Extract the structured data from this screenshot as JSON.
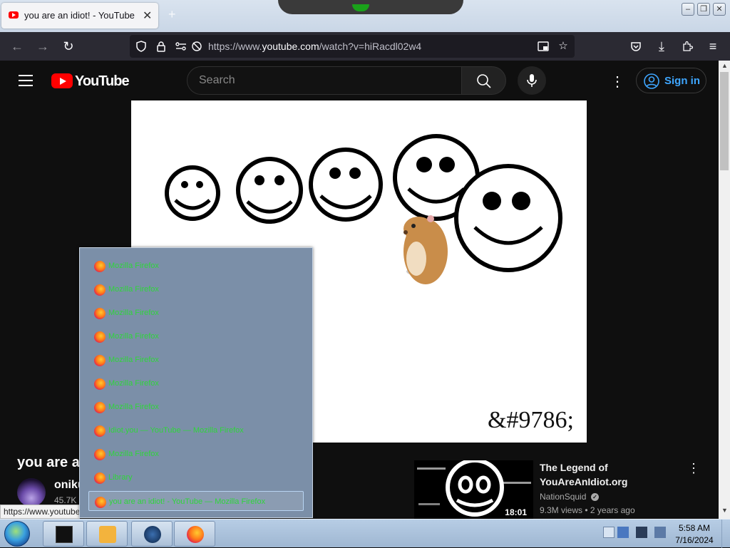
{
  "browser": {
    "tab_title": "you are an idiot! - YouTube",
    "tab_close": "✕",
    "new_tab": "+",
    "url_prefix": "https://www.",
    "url_domain": "youtube.com",
    "url_suffix": "/watch?v=hiRacdl02w4",
    "status_url": "https://www.youtube.com/"
  },
  "youtube": {
    "logo_text": "YouTube",
    "search_placeholder": "Search",
    "sign_in": "Sign in"
  },
  "video": {
    "caption": "&#9786;",
    "title": "you are an idiot!",
    "channel": "oniku",
    "subscribers": "45.7K subscribers"
  },
  "recommendation": {
    "title": "The Legend of YouAreAnIdiot.org",
    "channel": "NationSquid",
    "views": "9.3M views",
    "age": "2 years ago",
    "duration": "18:01"
  },
  "window_list": [
    {
      "label": "Mozilla Firefox"
    },
    {
      "label": "Mozilla Firefox"
    },
    {
      "label": "Mozilla Firefox"
    },
    {
      "label": "Mozilla Firefox"
    },
    {
      "label": "Mozilla Firefox"
    },
    {
      "label": "Mozilla Firefox"
    },
    {
      "label": "Mozilla Firefox"
    },
    {
      "label": "Idiot.you — YouTube — Mozilla Firefox"
    },
    {
      "label": "Mozilla Firefox"
    },
    {
      "label": "Library"
    },
    {
      "label": "you are an idiot! - YouTube — Mozilla Firefox",
      "selected": true
    }
  ],
  "taskbar": {
    "time": "5:58 AM",
    "date": "7/16/2024"
  },
  "colors": {
    "yt_red": "#ff0000",
    "link_blue": "#3ea6ff",
    "window_list_text": "#2fd53b"
  }
}
